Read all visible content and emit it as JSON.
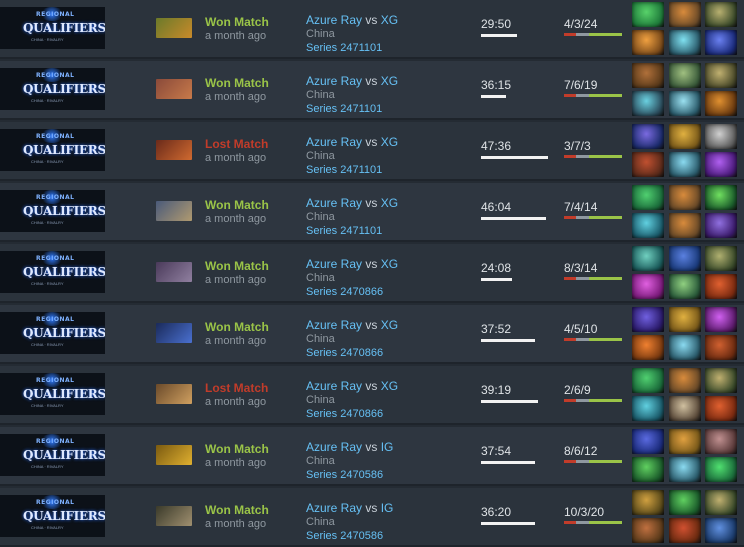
{
  "banner": {
    "top": "REGIONAL",
    "main": "QUALIFIERS",
    "sub": "CHINA · RIVALRY"
  },
  "colors": {
    "won": "#9ac448",
    "lost": "#c23c2a",
    "link": "#66c0f4",
    "muted": "#8f98a0"
  },
  "matches": [
    {
      "result": "Won Match",
      "outcome": "won",
      "when": "a month ago",
      "team1": "Azure Ray",
      "vs": "vs",
      "team2": "XG",
      "region": "China",
      "series": "Series 2471101",
      "duration": "29:50",
      "duration_fraction": 0.53,
      "kda": "4/3/24",
      "kda_split": [
        4,
        3,
        24
      ],
      "hero_color": [
        "#6b7a2a",
        "#c98a2a"
      ],
      "items": [
        [
          "#1e7a3a",
          "#58d26a"
        ],
        [
          "#6a4a28",
          "#d88b3c"
        ],
        [
          "#3b4a2a",
          "#b8b070"
        ],
        [
          "#7a4a1a",
          "#f0a040"
        ],
        [
          "#2a5a6a",
          "#7fe0f0"
        ],
        [
          "#1a2a7a",
          "#6a80f0"
        ]
      ]
    },
    {
      "result": "Won Match",
      "outcome": "won",
      "when": "a month ago",
      "team1": "Azure Ray",
      "vs": "vs",
      "team2": "XG",
      "region": "China",
      "series": "Series 2471101",
      "duration": "36:15",
      "duration_fraction": 0.37,
      "kda": "7/6/19",
      "kda_split": [
        7,
        6,
        19
      ],
      "hero_color": [
        "#8a4a3a",
        "#c87a4a"
      ],
      "items": [
        [
          "#5a3a1a",
          "#b0703a"
        ],
        [
          "#3a5a3a",
          "#a0c080"
        ],
        [
          "#4a4a2a",
          "#c0b070"
        ],
        [
          "#2a4a5a",
          "#6ad0e0"
        ],
        [
          "#2a5a6a",
          "#9ae0f0"
        ],
        [
          "#6a3a10",
          "#e09030"
        ]
      ]
    },
    {
      "result": "Lost Match",
      "outcome": "lost",
      "when": "a month ago",
      "team1": "Azure Ray",
      "vs": "vs",
      "team2": "XG",
      "region": "China",
      "series": "Series 2471101",
      "duration": "47:36",
      "duration_fraction": 1.0,
      "kda": "3/7/3",
      "kda_split": [
        3,
        7,
        3
      ],
      "hero_color": [
        "#6a2a1a",
        "#d06a30"
      ],
      "items": [
        [
          "#1a2a6a",
          "#7a6ae0"
        ],
        [
          "#7a5a1a",
          "#e0b040"
        ],
        [
          "#5a5a5a",
          "#d0d0d0"
        ],
        [
          "#5a2a1a",
          "#c05030"
        ],
        [
          "#2a5a6a",
          "#8adaf0"
        ],
        [
          "#4a1a7a",
          "#b060f0"
        ]
      ]
    },
    {
      "result": "Won Match",
      "outcome": "won",
      "when": "a month ago",
      "team1": "Azure Ray",
      "vs": "vs",
      "team2": "XG",
      "region": "China",
      "series": "Series 2471101",
      "duration": "46:04",
      "duration_fraction": 0.97,
      "kda": "7/4/14",
      "kda_split": [
        7,
        4,
        14
      ],
      "hero_color": [
        "#4a5a7a",
        "#b09a70"
      ],
      "items": [
        [
          "#1a6a3a",
          "#50d070"
        ],
        [
          "#6a4a28",
          "#d88b3c"
        ],
        [
          "#1a5a2a",
          "#70e060"
        ],
        [
          "#1a5a6a",
          "#60d0e0"
        ],
        [
          "#6a4a28",
          "#d88b3c"
        ],
        [
          "#3a1a6a",
          "#9070e0"
        ]
      ]
    },
    {
      "result": "Won Match",
      "outcome": "won",
      "when": "a month ago",
      "team1": "Azure Ray",
      "vs": "vs",
      "team2": "XG",
      "region": "China",
      "series": "Series 2470866",
      "duration": "24:08",
      "duration_fraction": 0.47,
      "kda": "8/3/14",
      "kda_split": [
        8,
        3,
        14
      ],
      "hero_color": [
        "#4a3a5a",
        "#9080a0"
      ],
      "items": [
        [
          "#1a5a5a",
          "#70d0c0"
        ],
        [
          "#1a3a7a",
          "#5a80e0"
        ],
        [
          "#3a4a2a",
          "#b0b070"
        ],
        [
          "#7a1a7a",
          "#e060e0"
        ],
        [
          "#2a5a3a",
          "#90d080"
        ],
        [
          "#7a2a10",
          "#e06030"
        ]
      ]
    },
    {
      "result": "Won Match",
      "outcome": "won",
      "when": "a month ago",
      "team1": "Azure Ray",
      "vs": "vs",
      "team2": "XG",
      "region": "China",
      "series": "Series 2470866",
      "duration": "37:52",
      "duration_fraction": 0.8,
      "kda": "4/5/10",
      "kda_split": [
        4,
        5,
        10
      ],
      "hero_color": [
        "#1a2a5a",
        "#4a70d0"
      ],
      "items": [
        [
          "#2a1a6a",
          "#7060e0"
        ],
        [
          "#7a5a1a",
          "#e0b040"
        ],
        [
          "#5a1a6a",
          "#d060f0"
        ],
        [
          "#7a3a10",
          "#f08030"
        ],
        [
          "#2a5a6a",
          "#8adaf0"
        ],
        [
          "#6a2a10",
          "#d06030"
        ]
      ]
    },
    {
      "result": "Lost Match",
      "outcome": "lost",
      "when": "a month ago",
      "team1": "Azure Ray",
      "vs": "vs",
      "team2": "XG",
      "region": "China",
      "series": "Series 2470866",
      "duration": "39:19",
      "duration_fraction": 0.85,
      "kda": "2/6/9",
      "kda_split": [
        2,
        6,
        9
      ],
      "hero_color": [
        "#6a4a2a",
        "#d0a060"
      ],
      "items": [
        [
          "#1a6a3a",
          "#50d070"
        ],
        [
          "#6a4a28",
          "#d88b3c"
        ],
        [
          "#3a4a2a",
          "#c0b070"
        ],
        [
          "#1a5a6a",
          "#60d0e0"
        ],
        [
          "#5a4a3a",
          "#d0c0a0"
        ],
        [
          "#7a2a10",
          "#e06030"
        ]
      ]
    },
    {
      "result": "Won Match",
      "outcome": "won",
      "when": "a month ago",
      "team1": "Azure Ray",
      "vs": "vs",
      "team2": "IG",
      "region": "China",
      "series": "Series 2470586",
      "duration": "37:54",
      "duration_fraction": 0.8,
      "kda": "8/6/12",
      "kda_split": [
        8,
        6,
        12
      ],
      "hero_color": [
        "#7a5a10",
        "#e0b030"
      ],
      "items": [
        [
          "#1a2a7a",
          "#5a6ae0"
        ],
        [
          "#7a5a1a",
          "#e0a040"
        ],
        [
          "#5a3a3a",
          "#c09090"
        ],
        [
          "#1a5a2a",
          "#60d060"
        ],
        [
          "#2a5a6a",
          "#8adaf0"
        ],
        [
          "#1a6a3a",
          "#50e070"
        ]
      ]
    },
    {
      "result": "Won Match",
      "outcome": "won",
      "when": "a month ago",
      "team1": "Azure Ray",
      "vs": "vs",
      "team2": "IG",
      "region": "China",
      "series": "Series 2470586",
      "duration": "36:20",
      "duration_fraction": 0.8,
      "kda": "10/3/20",
      "kda_split": [
        10,
        3,
        20
      ],
      "hero_color": [
        "#3a3a2a",
        "#a09070"
      ],
      "items": [
        [
          "#5a4a1a",
          "#d0a040"
        ],
        [
          "#1a5a2a",
          "#60d060"
        ],
        [
          "#3a4a2a",
          "#c0b070"
        ],
        [
          "#5a3a1a",
          "#c07040"
        ],
        [
          "#6a2a10",
          "#d05030"
        ],
        [
          "#1a3a6a",
          "#6090e0"
        ]
      ]
    }
  ]
}
